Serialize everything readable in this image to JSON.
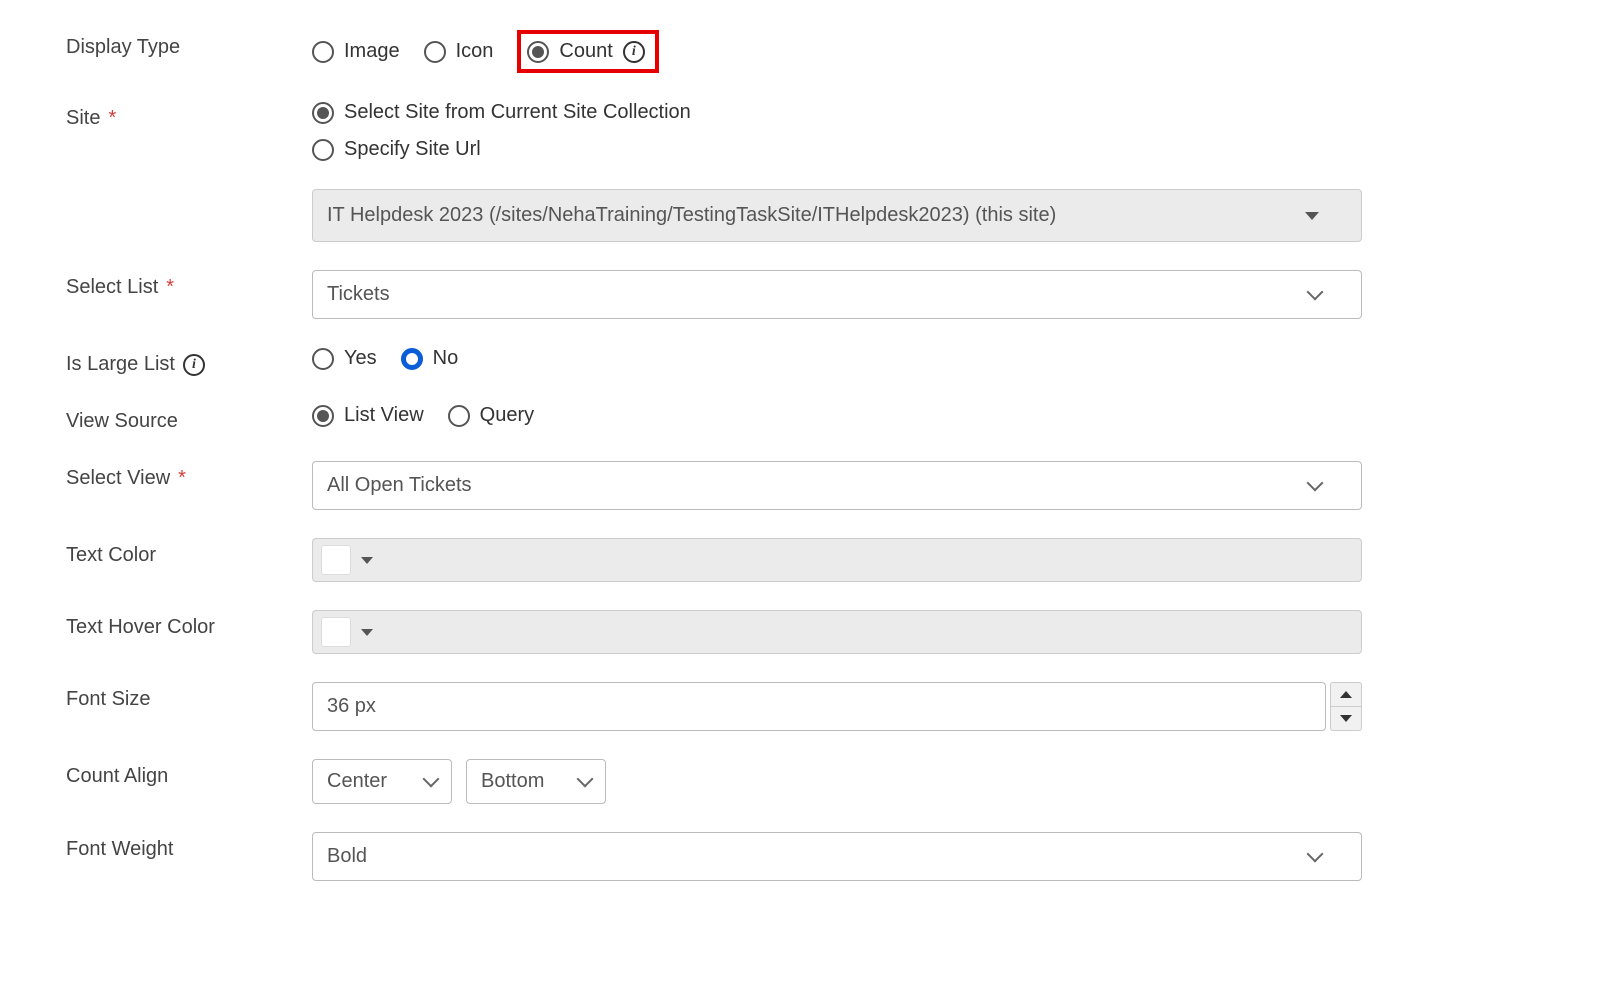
{
  "displayType": {
    "label": "Display Type",
    "options": {
      "image": "Image",
      "icon": "Icon",
      "count": "Count"
    },
    "selected": "count"
  },
  "site": {
    "label": "Site",
    "options": {
      "selectFromCollection": "Select Site from Current Site Collection",
      "specifyUrl": "Specify Site Url"
    },
    "selected": "selectFromCollection",
    "dropdownValue": "IT Helpdesk 2023 (/sites/NehaTraining/TestingTaskSite/ITHelpdesk2023) (this site)"
  },
  "selectList": {
    "label": "Select List",
    "value": "Tickets"
  },
  "isLargeList": {
    "label": "Is Large List",
    "options": {
      "yes": "Yes",
      "no": "No"
    },
    "selected": "no"
  },
  "viewSource": {
    "label": "View Source",
    "options": {
      "listView": "List View",
      "query": "Query"
    },
    "selected": "listView"
  },
  "selectView": {
    "label": "Select View",
    "value": "All Open Tickets"
  },
  "textColor": {
    "label": "Text Color",
    "value": "#ffffff"
  },
  "textHoverColor": {
    "label": "Text Hover Color",
    "value": "#ffffff"
  },
  "fontSize": {
    "label": "Font Size",
    "value": "36 px"
  },
  "countAlign": {
    "label": "Count Align",
    "horizontal": "Center",
    "vertical": "Bottom"
  },
  "fontWeight": {
    "label": "Font Weight",
    "value": "Bold"
  }
}
